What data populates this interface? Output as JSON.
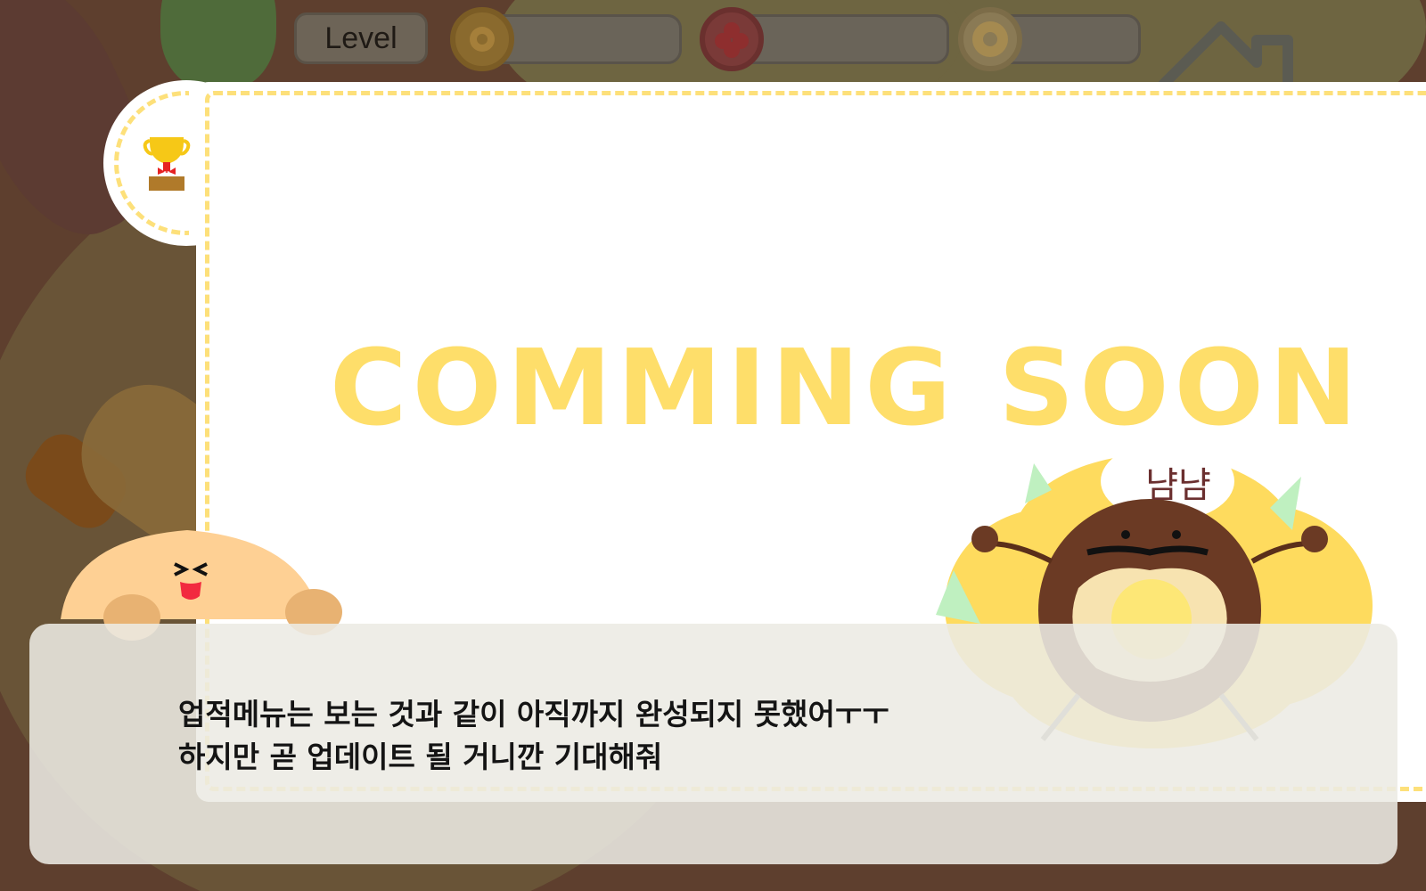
{
  "hud": {
    "level_label": "Level"
  },
  "achievement": {
    "banner": "COMMING SOON",
    "mascot_sign": "냠냠"
  },
  "dialog": {
    "line1": "업적메뉴는 보는 것과 같이 아직까지 완성되지 못했어ㅜㅜ",
    "line2": "하지만 곧 업데이트 될 거니깐 기대해줘"
  },
  "colors": {
    "accent_yellow": "#fede6a",
    "background_brown": "#5e3f2e",
    "panel_white": "#ffffff"
  }
}
